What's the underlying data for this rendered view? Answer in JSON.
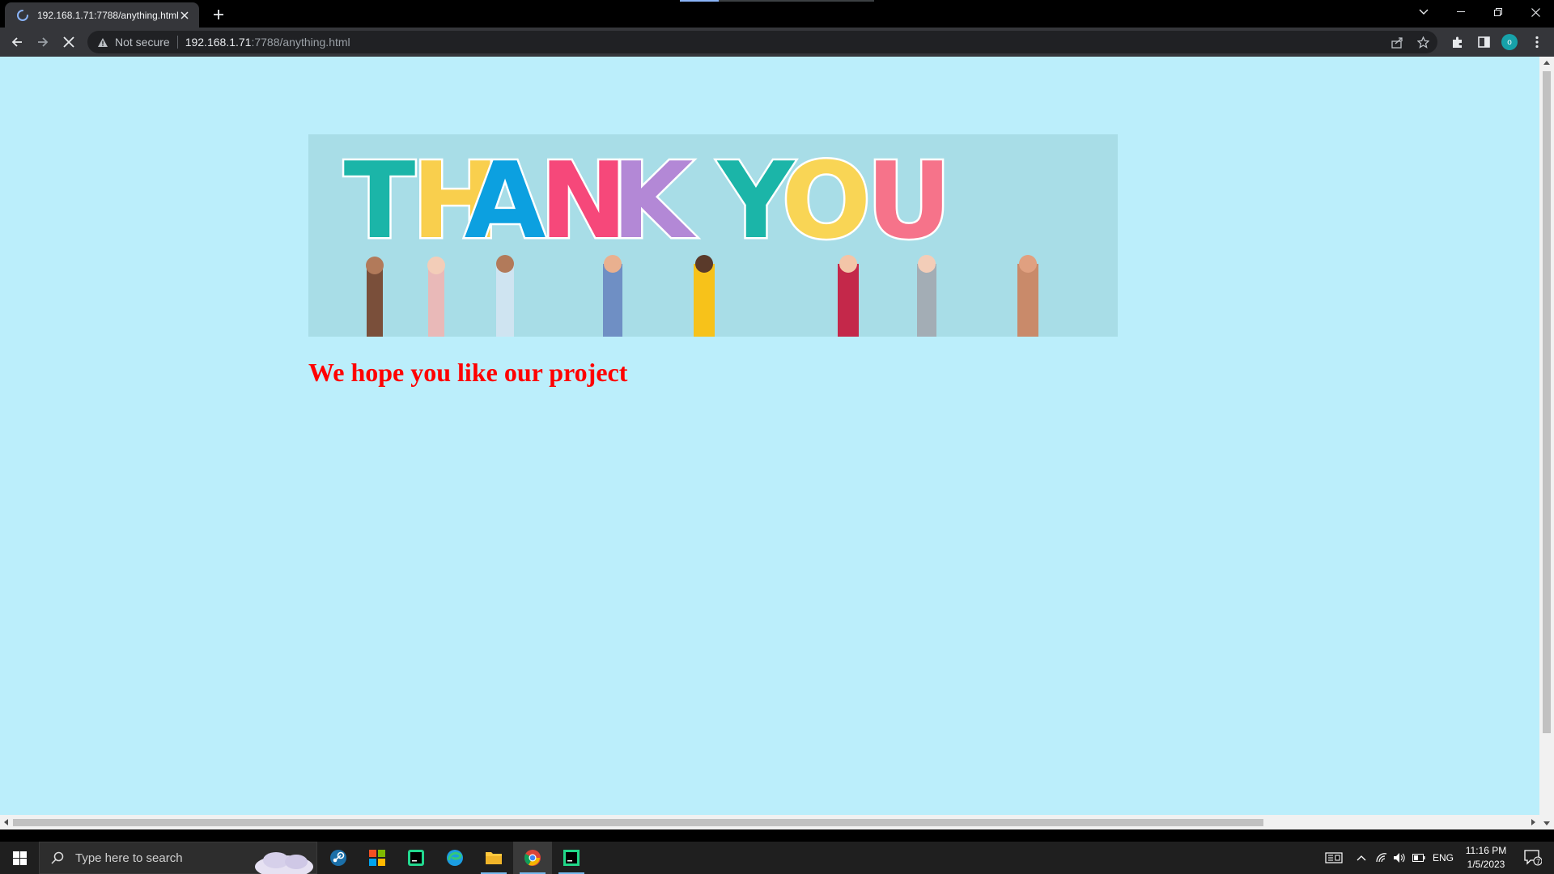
{
  "tab": {
    "title": "192.168.1.71:7788/anything.html"
  },
  "omnibox": {
    "security_label": "Not secure",
    "url_host": "192.168.1.71",
    "url_rest": ":7788/anything.html"
  },
  "profile": {
    "initial": "o",
    "color": "#17a2a9"
  },
  "page": {
    "background": "#bbeefb",
    "banner": {
      "letters": [
        "T",
        "H",
        "A",
        "N",
        "K",
        "Y",
        "O",
        "U"
      ],
      "letter_colors": [
        "#1bb5a8",
        "#f9cf4d",
        "#0ca0e0",
        "#f6487a",
        "#b388d6",
        "#1bb5a8",
        "#f9d555",
        "#f6738a"
      ]
    },
    "heading": "We hope you like our project",
    "heading_color": "#ff0000"
  },
  "taskbar": {
    "search_placeholder": "Type here to search",
    "apps": [
      "steam-icon",
      "app-tiles-icon",
      "clion-icon",
      "edge-icon",
      "file-explorer-icon",
      "chrome-icon",
      "pycharm-icon"
    ],
    "language": "ENG",
    "time": "11:16 PM",
    "date": "1/5/2023",
    "notification_count": "7"
  }
}
